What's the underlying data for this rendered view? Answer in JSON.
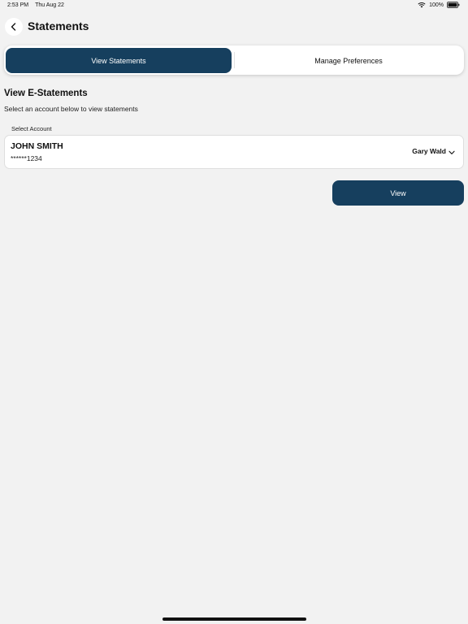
{
  "status_bar": {
    "time": "2:53 PM",
    "date": "Thu Aug 22",
    "battery": "100%",
    "icons": [
      "wifi-icon",
      "battery-icon"
    ]
  },
  "header": {
    "back_icon": "chevron-left-icon",
    "title": "Statements"
  },
  "tabs": [
    {
      "label": "View Statements",
      "active": true
    },
    {
      "label": "Manage Preferences",
      "active": false
    }
  ],
  "section": {
    "title": "View E-Statements",
    "subtitle": "Select an account below to view statements"
  },
  "account_select": {
    "label": "Select Account",
    "account_name": "JOHN SMITH",
    "account_number": "******1234",
    "owner": "Gary Wald",
    "dropdown_icon": "chevron-down-icon"
  },
  "actions": {
    "view_label": "View"
  },
  "colors": {
    "primary": "#163f5e",
    "background": "#f2f2f2",
    "card": "#ffffff"
  }
}
